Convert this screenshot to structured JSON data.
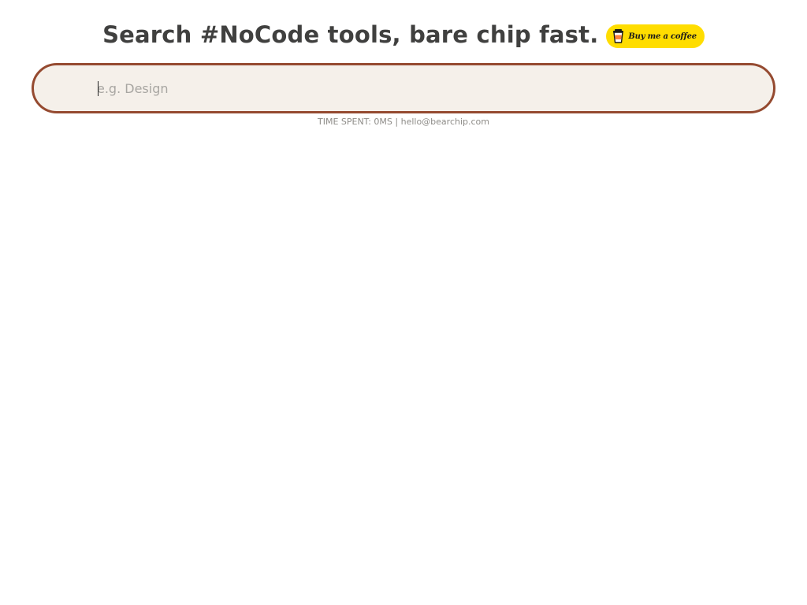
{
  "header": {
    "headline": "Search #NoCode tools, bare chip fast.",
    "support_button": {
      "label": "Buy me a coffee",
      "icon": "coffee-cup-icon",
      "background": "#ffdd00"
    }
  },
  "search": {
    "value": "",
    "placeholder": "e.g. Design",
    "border_color": "#954a30",
    "background": "#f5f0ea"
  },
  "status": {
    "time_spent": "TIME SPENT: 0MS",
    "separator": "|",
    "email": "hello@bearchip.com"
  }
}
